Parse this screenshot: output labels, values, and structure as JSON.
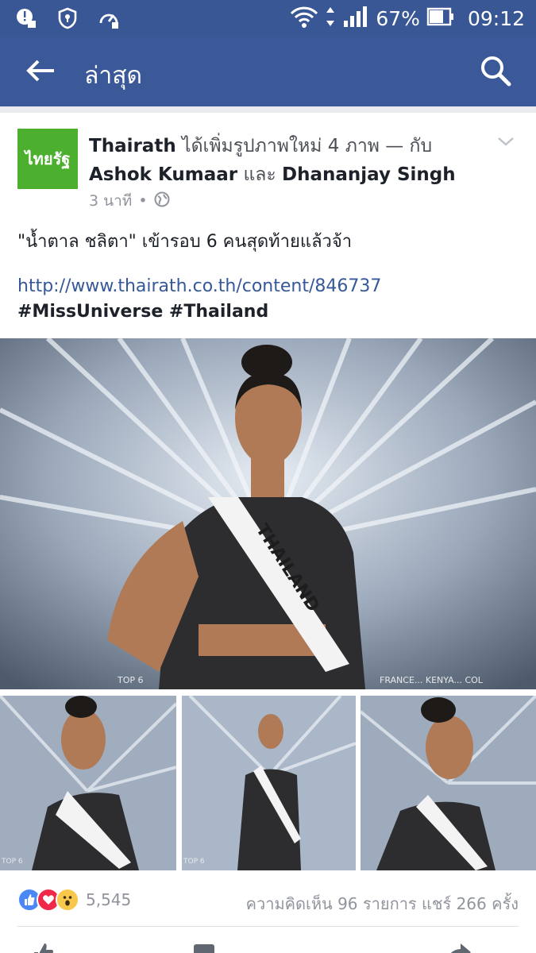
{
  "status_bar": {
    "battery": "67%",
    "time": "09:12"
  },
  "app_bar": {
    "title": "ล่าสุด"
  },
  "post": {
    "page_name": "Thairath",
    "avatar_text": "ไทยรัฐ",
    "header_action": "ได้เพิ่มรูปภาพใหม่ 4 ภาพ — กับ",
    "tagged_1": "Ashok Kumaar",
    "conjunction": "และ",
    "tagged_2": "Dhananjay Singh",
    "time_ago": "3 นาที",
    "separator": "•",
    "text": "\"น้ำตาล ชลิตา\" เข้ารอบ 6 คนสุดท้ายแล้วจ้า",
    "link": "http://www.thairath.co.th/content/846737",
    "hashtags": "#MissUniverse #Thailand",
    "photo_caption_main_left": "TOP 6",
    "photo_caption_main_right": "FRANCE... KENYA... COL",
    "sash_text": "THAILAND",
    "photo_caption_small": "TOP 6"
  },
  "reactions": {
    "count": "5,545",
    "stats": "ความคิดเห็น 96 รายการ แชร์ 266 ครั้ง"
  },
  "colors": {
    "facebook_blue": "#3b5998",
    "status_blue": "#3a5795",
    "link_blue": "#365899",
    "like_blue": "#4b88f6",
    "love_red": "#f0284a",
    "wow_yellow": "#f7c84b"
  }
}
